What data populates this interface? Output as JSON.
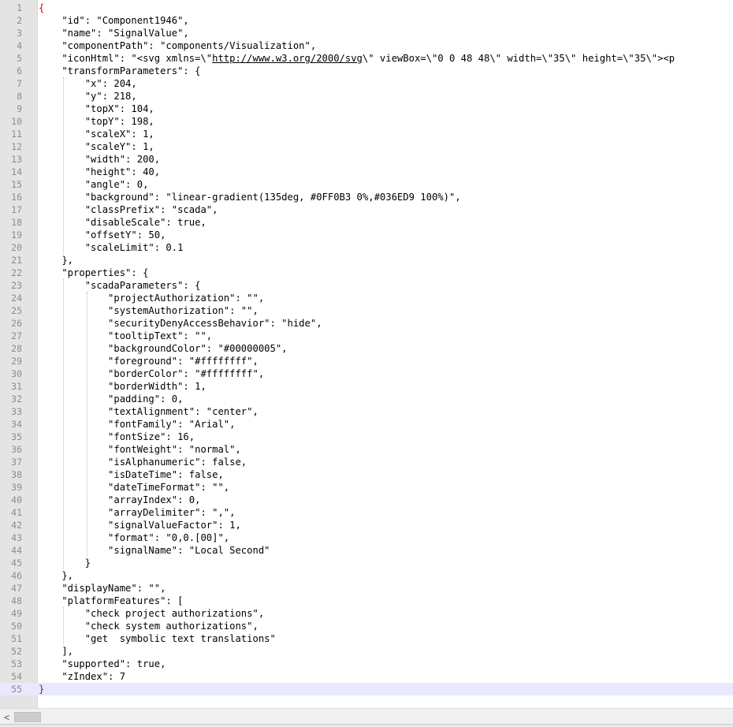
{
  "editor": {
    "current_line": 55,
    "lines": [
      {
        "n": "1",
        "text": "{"
      },
      {
        "n": "2",
        "text": "    \"id\": \"Component1946\","
      },
      {
        "n": "3",
        "text": "    \"name\": \"SignalValue\","
      },
      {
        "n": "4",
        "text": "    \"componentPath\": \"components/Visualization\","
      },
      {
        "n": "5",
        "text": "    \"iconHtml\": \"<svg xmlns=\\\"http://www.w3.org/2000/svg\\\" viewBox=\\\"0 0 48 48\\\" width=\\\"35\\\" height=\\\"35\\\"><p"
      },
      {
        "n": "6",
        "text": "    \"transformParameters\": {"
      },
      {
        "n": "7",
        "text": "        \"x\": 204,"
      },
      {
        "n": "8",
        "text": "        \"y\": 218,"
      },
      {
        "n": "9",
        "text": "        \"topX\": 104,"
      },
      {
        "n": "10",
        "text": "        \"topY\": 198,"
      },
      {
        "n": "11",
        "text": "        \"scaleX\": 1,"
      },
      {
        "n": "12",
        "text": "        \"scaleY\": 1,"
      },
      {
        "n": "13",
        "text": "        \"width\": 200,"
      },
      {
        "n": "14",
        "text": "        \"height\": 40,"
      },
      {
        "n": "15",
        "text": "        \"angle\": 0,"
      },
      {
        "n": "16",
        "text": "        \"background\": \"linear-gradient(135deg, #0FF0B3 0%,#036ED9 100%)\","
      },
      {
        "n": "17",
        "text": "        \"classPrefix\": \"scada\","
      },
      {
        "n": "18",
        "text": "        \"disableScale\": true,"
      },
      {
        "n": "19",
        "text": "        \"offsetY\": 50,"
      },
      {
        "n": "20",
        "text": "        \"scaleLimit\": 0.1"
      },
      {
        "n": "21",
        "text": "    },"
      },
      {
        "n": "22",
        "text": "    \"properties\": {"
      },
      {
        "n": "23",
        "text": "        \"scadaParameters\": {"
      },
      {
        "n": "24",
        "text": "            \"projectAuthorization\": \"\","
      },
      {
        "n": "25",
        "text": "            \"systemAuthorization\": \"\","
      },
      {
        "n": "26",
        "text": "            \"securityDenyAccessBehavior\": \"hide\","
      },
      {
        "n": "27",
        "text": "            \"tooltipText\": \"\","
      },
      {
        "n": "28",
        "text": "            \"backgroundColor\": \"#00000005\","
      },
      {
        "n": "29",
        "text": "            \"foreground\": \"#ffffffff\","
      },
      {
        "n": "30",
        "text": "            \"borderColor\": \"#ffffffff\","
      },
      {
        "n": "31",
        "text": "            \"borderWidth\": 1,"
      },
      {
        "n": "32",
        "text": "            \"padding\": 0,"
      },
      {
        "n": "33",
        "text": "            \"textAlignment\": \"center\","
      },
      {
        "n": "34",
        "text": "            \"fontFamily\": \"Arial\","
      },
      {
        "n": "35",
        "text": "            \"fontSize\": 16,"
      },
      {
        "n": "36",
        "text": "            \"fontWeight\": \"normal\","
      },
      {
        "n": "37",
        "text": "            \"isAlphanumeric\": false,"
      },
      {
        "n": "38",
        "text": "            \"isDateTime\": false,"
      },
      {
        "n": "39",
        "text": "            \"dateTimeFormat\": \"\","
      },
      {
        "n": "40",
        "text": "            \"arrayIndex\": 0,"
      },
      {
        "n": "41",
        "text": "            \"arrayDelimiter\": \",\","
      },
      {
        "n": "42",
        "text": "            \"signalValueFactor\": 1,"
      },
      {
        "n": "43",
        "text": "            \"format\": \"0,0.[00]\","
      },
      {
        "n": "44",
        "text": "            \"signalName\": \"Local Second\""
      },
      {
        "n": "45",
        "text": "        }"
      },
      {
        "n": "46",
        "text": "    },"
      },
      {
        "n": "47",
        "text": "    \"displayName\": \"\","
      },
      {
        "n": "48",
        "text": "    \"platformFeatures\": ["
      },
      {
        "n": "49",
        "text": "        \"check project authorizations\","
      },
      {
        "n": "50",
        "text": "        \"check system authorizations\","
      },
      {
        "n": "51",
        "text": "        \"get  symbolic text translations\""
      },
      {
        "n": "52",
        "text": "    ],"
      },
      {
        "n": "53",
        "text": "    \"supported\": true,"
      },
      {
        "n": "54",
        "text": "    \"zIndex\": 7"
      },
      {
        "n": "55",
        "text": "}"
      }
    ]
  },
  "scrollbar": {
    "left_arrow_icon": "chevron-left-icon",
    "left_arrow_glyph": "<"
  },
  "colors": {
    "gutter": "#e4e4e4",
    "current_line": "#e8e8ff",
    "brace": "#e00000",
    "line_number": "#8c8c8c"
  }
}
